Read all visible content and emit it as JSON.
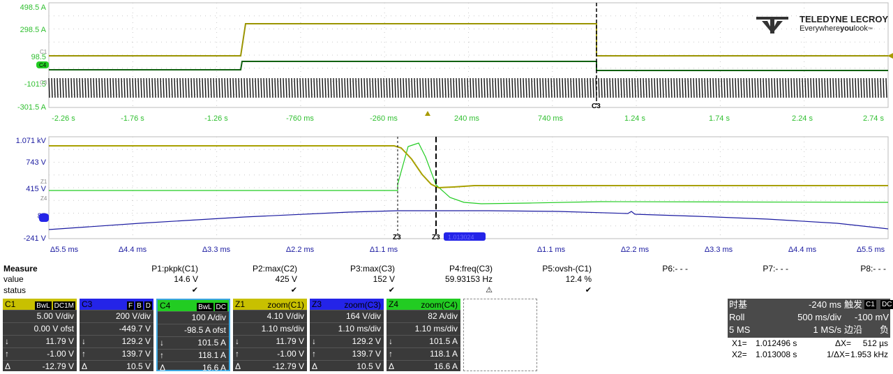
{
  "brand": {
    "name": "TELEDYNE LECROY",
    "tagline_a": "Everywhere",
    "tagline_b": "you",
    "tagline_c": "look",
    "tm": "™"
  },
  "top_grid": {
    "y_labels": [
      "498.5 A",
      "298.5 A",
      "98.5",
      "-101.5",
      "-301.5 A"
    ],
    "x_labels": [
      "-2.26 s",
      "-1.76 s",
      "-1.26 s",
      "-760 ms",
      "-260 ms",
      "240 ms",
      "740 ms",
      "1.24 s",
      "1.74 s",
      "2.24 s",
      "2.74 s"
    ],
    "markers": {
      "c1": "C1",
      "c4": "C4",
      "c3": "C3",
      "cursor": "C3"
    }
  },
  "bottom_grid": {
    "y_labels": [
      "1.071 kV",
      "743 V",
      "415 V",
      "87",
      "-241 V"
    ],
    "x_labels": [
      "Δ5.5 ms",
      "Δ4.4 ms",
      "Δ3.3 ms",
      "Δ2.2 ms",
      "Δ1.1 ms",
      "Δ1.1 ms",
      "Δ2.2 ms",
      "Δ3.3 ms",
      "Δ4.4 ms",
      "Δ5.5 ms"
    ],
    "markers": {
      "z1": "Z1",
      "z4": "Z4",
      "za": "Z3",
      "zb": "Z3"
    }
  },
  "measure": {
    "title": "Measure",
    "row_value": "value",
    "row_status": "status",
    "params": [
      {
        "name": "P1:pkpk(C1)",
        "value": "14.6 V",
        "status": "✔"
      },
      {
        "name": "P2:max(C2)",
        "value": "425 V",
        "status": "✔"
      },
      {
        "name": "P3:max(C3)",
        "value": "152 V",
        "status": "✔"
      },
      {
        "name": "P4:freq(C3)",
        "value": "59.93153 Hz",
        "status": "⚠"
      },
      {
        "name": "P5:ovsh-(C1)",
        "value": "12.4 %",
        "status": "✔"
      },
      {
        "name": "P6:- - -",
        "value": "",
        "status": ""
      },
      {
        "name": "P7:- - -",
        "value": "",
        "status": ""
      },
      {
        "name": "P8:- - -",
        "value": "",
        "status": ""
      }
    ]
  },
  "channels": [
    {
      "name": "C1",
      "tags": [
        "BwL",
        "DC1M"
      ],
      "color": "#c8c000",
      "rows": [
        [
          "",
          "5.00 V/div"
        ],
        [
          "",
          "0.00 V ofst"
        ],
        [
          "↓",
          "11.79 V"
        ],
        [
          "↑",
          "-1.00 V"
        ],
        [
          "Δ",
          "-12.79 V"
        ]
      ]
    },
    {
      "name": "C3",
      "tags": [
        "F",
        "B",
        "D"
      ],
      "color": "#2424e8",
      "rows": [
        [
          "",
          "200 V/div"
        ],
        [
          "",
          "-449.7 V"
        ],
        [
          "↓",
          "129.2 V"
        ],
        [
          "↑",
          "139.7 V"
        ],
        [
          "Δ",
          "10.5 V"
        ]
      ]
    },
    {
      "name": "C4",
      "tags": [
        "BwL",
        "DC"
      ],
      "color": "#22cc22",
      "rows": [
        [
          "",
          "100 A/div"
        ],
        [
          "",
          "-98.5 A ofst"
        ],
        [
          "↓",
          "101.5 A"
        ],
        [
          "↑",
          "118.1 A"
        ],
        [
          "Δ",
          "16.6 A"
        ]
      ]
    },
    {
      "name": "Z1",
      "tags": [
        "zoom(C1)"
      ],
      "color": "#c8c000",
      "rows": [
        [
          "",
          "4.10 V/div"
        ],
        [
          "",
          "1.10 ms/div"
        ],
        [
          "↓",
          "11.79 V"
        ],
        [
          "↑",
          "-1.00 V"
        ],
        [
          "Δ",
          "-12.79 V"
        ]
      ]
    },
    {
      "name": "Z3",
      "tags": [
        "zoom(C3)"
      ],
      "color": "#2424e8",
      "rows": [
        [
          "",
          "164 V/div"
        ],
        [
          "",
          "1.10 ms/div"
        ],
        [
          "↓",
          "129.2 V"
        ],
        [
          "↑",
          "139.7 V"
        ],
        [
          "Δ",
          "10.5 V"
        ]
      ]
    },
    {
      "name": "Z4",
      "tags": [
        "zoom(C4)"
      ],
      "color": "#22cc22",
      "rows": [
        [
          "",
          "82 A/div"
        ],
        [
          "",
          "1.10 ms/div"
        ],
        [
          "↓",
          "101.5 A"
        ],
        [
          "↑",
          "118.1 A"
        ],
        [
          "Δ",
          "16.6 A"
        ]
      ]
    }
  ],
  "timebase": {
    "label": "时基",
    "delay": "-240 ms",
    "mode": "Roll",
    "tdiv": "500 ms/div",
    "samples": "5 MS",
    "rate": "1 MS/s"
  },
  "trigger": {
    "label": "触发",
    "src": "C1",
    "coupling": "DC",
    "level": "-100 mV",
    "type": "边沿",
    "slope": "负"
  },
  "cursors": {
    "x1_label": "X1=",
    "x1": "1.012496 s",
    "dx_label": "ΔX=",
    "dx": "512 µs",
    "x2_label": "X2=",
    "x2": "1.013008 s",
    "inv_label": "1/ΔX=",
    "inv": "1.953 kHz"
  },
  "zoom_badge": "1.013024",
  "colors": {
    "c1": "#a8a000",
    "c3": "#1a1aa0",
    "c4": "#22cc22",
    "c4dark": "#106010",
    "grid": "#c8c8c8",
    "axis": "#2fbf2f"
  }
}
